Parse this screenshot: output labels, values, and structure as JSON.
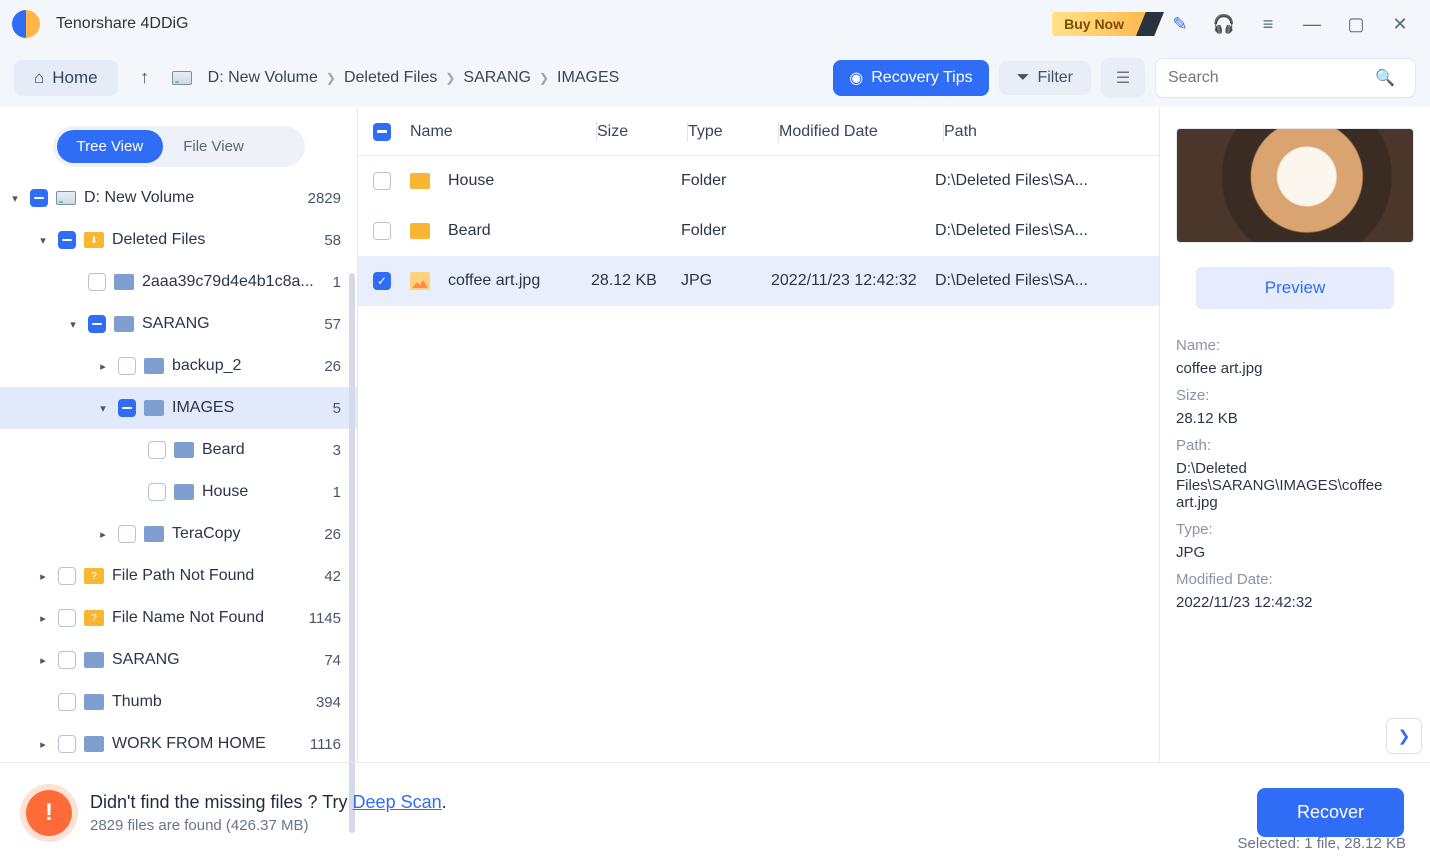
{
  "app": {
    "title": "Tenorshare 4DDiG",
    "buy_now": "Buy Now"
  },
  "toolbar": {
    "home": "Home",
    "breadcrumb": [
      "D: New Volume",
      "Deleted Files",
      "SARANG",
      "IMAGES"
    ],
    "recovery_tips": "Recovery Tips",
    "filter": "Filter",
    "search_placeholder": "Search"
  },
  "sidebar": {
    "tabs": {
      "tree": "Tree View",
      "file": "File View"
    },
    "rows": [
      {
        "pad": 8,
        "chev": "down",
        "chk": "indet",
        "icoClass": "ico-drive",
        "label": "D: New Volume",
        "count": "2829"
      },
      {
        "pad": 36,
        "chev": "down",
        "chk": "indet",
        "icoClass": "ico-folder ylw2",
        "label": "Deleted Files",
        "count": "58"
      },
      {
        "pad": 66,
        "chev": "",
        "chk": "",
        "icoClass": "ico-folder blue",
        "label": "2aaa39c79d4e4b1c8a...",
        "count": "1"
      },
      {
        "pad": 66,
        "chev": "down",
        "chk": "indet",
        "icoClass": "ico-folder blue",
        "label": "SARANG",
        "count": "57"
      },
      {
        "pad": 96,
        "chev": "right",
        "chk": "",
        "icoClass": "ico-folder blue",
        "label": "backup_2",
        "count": "26"
      },
      {
        "pad": 96,
        "chev": "down",
        "chk": "indet",
        "icoClass": "ico-folder blue",
        "label": "IMAGES",
        "count": "5",
        "sel": true
      },
      {
        "pad": 126,
        "chev": "",
        "chk": "",
        "icoClass": "ico-folder blue",
        "label": "Beard",
        "count": "3"
      },
      {
        "pad": 126,
        "chev": "",
        "chk": "",
        "icoClass": "ico-folder blue",
        "label": "House",
        "count": "1"
      },
      {
        "pad": 96,
        "chev": "right",
        "chk": "",
        "icoClass": "ico-folder blue",
        "label": "TeraCopy",
        "count": "26"
      },
      {
        "pad": 36,
        "chev": "right",
        "chk": "",
        "icoClass": "ico-folder ylw3",
        "label": "File Path Not Found",
        "count": "42"
      },
      {
        "pad": 36,
        "chev": "right",
        "chk": "",
        "icoClass": "ico-folder ylw3",
        "label": "File Name Not Found",
        "count": "1145"
      },
      {
        "pad": 36,
        "chev": "right",
        "chk": "",
        "icoClass": "ico-folder blue",
        "label": "SARANG",
        "count": "74"
      },
      {
        "pad": 36,
        "chev": "",
        "chk": "",
        "icoClass": "ico-folder blue",
        "label": "Thumb",
        "count": "394"
      },
      {
        "pad": 36,
        "chev": "right",
        "chk": "",
        "icoClass": "ico-folder blue",
        "label": "WORK FROM HOME",
        "count": "1116"
      }
    ]
  },
  "filelist": {
    "headers": {
      "name": "Name",
      "size": "Size",
      "type": "Type",
      "date": "Modified Date",
      "path": "Path"
    },
    "rows": [
      {
        "chk": "",
        "icoClass": "ico-folder ylw",
        "name": "House",
        "size": "",
        "type": "Folder",
        "date": "",
        "path": "D:\\Deleted Files\\SA..."
      },
      {
        "chk": "",
        "icoClass": "ico-folder ylw",
        "name": "Beard",
        "size": "",
        "type": "Folder",
        "date": "",
        "path": "D:\\Deleted Files\\SA..."
      },
      {
        "chk": "checked",
        "icoClass": "ico-img",
        "name": "coffee art.jpg",
        "size": "28.12 KB",
        "type": "JPG",
        "date": "2022/11/23 12:42:32",
        "path": "D:\\Deleted Files\\SA...",
        "sel": true
      }
    ]
  },
  "preview": {
    "button": "Preview",
    "name_lbl": "Name:",
    "name": "coffee art.jpg",
    "size_lbl": "Size:",
    "size": "28.12 KB",
    "path_lbl": "Path:",
    "path": "D:\\Deleted Files\\SARANG\\IMAGES\\coffee art.jpg",
    "type_lbl": "Type:",
    "type": "JPG",
    "date_lbl": "Modified Date:",
    "date": "2022/11/23 12:42:32"
  },
  "footer": {
    "headline_pre": "Didn't find the missing files ? Try ",
    "headline_link": "Deep Scan",
    "headline_post": ".",
    "sub": "2829 files are found (426.37 MB)",
    "recover": "Recover",
    "selected": "Selected: 1 file, 28.12 KB"
  }
}
